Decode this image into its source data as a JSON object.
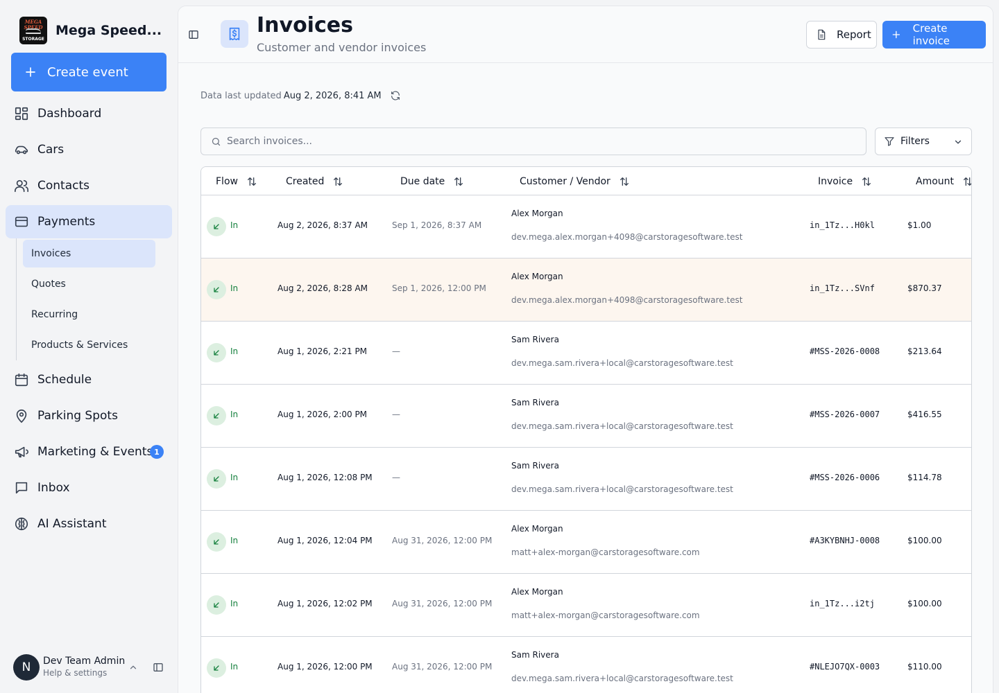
{
  "org": {
    "name": "Mega Speed...",
    "logo_text_top": "MEGA SPEED",
    "logo_text_bottom": "STORAGE"
  },
  "sidebar": {
    "create_event_label": "Create event",
    "items": [
      {
        "label": "Dashboard",
        "icon": "dashboard-icon"
      },
      {
        "label": "Cars",
        "icon": "car-icon"
      },
      {
        "label": "Contacts",
        "icon": "contacts-icon"
      },
      {
        "label": "Payments",
        "icon": "credit-card-icon"
      },
      {
        "label": "Schedule",
        "icon": "calendar-icon"
      },
      {
        "label": "Parking Spots",
        "icon": "map-pin-icon"
      },
      {
        "label": "Marketing & Events",
        "icon": "megaphone-icon",
        "badge": "1"
      },
      {
        "label": "Inbox",
        "icon": "message-icon"
      },
      {
        "label": "AI Assistant",
        "icon": "brain-icon"
      }
    ],
    "payments_sub": [
      {
        "label": "Invoices"
      },
      {
        "label": "Quotes"
      },
      {
        "label": "Recurring"
      },
      {
        "label": "Products & Services"
      }
    ]
  },
  "user": {
    "initial": "N",
    "name": "Dev Team Admin",
    "subtitle": "Help & settings"
  },
  "header": {
    "title": "Invoices",
    "subtitle": "Customer and vendor invoices",
    "report_label": "Report",
    "create_label": "Create invoice"
  },
  "status": {
    "updated_label": "Data last updated",
    "updated_value": "Aug 2, 2026, 8:41 AM"
  },
  "search": {
    "placeholder": "Search invoices..."
  },
  "filters_label": "Filters",
  "table": {
    "columns": [
      "Flow",
      "Created",
      "Due date",
      "Customer / Vendor",
      "Invoice",
      "Amount"
    ],
    "rows": [
      {
        "flow": "In",
        "created": "Aug 2, 2026, 8:37 AM",
        "due": "Sep 1, 2026, 8:37 AM",
        "name": "Alex Morgan",
        "email": "dev.mega.alex.morgan+4098@carstoragesoftware.test",
        "invoice": "in_1Tz...H0kl",
        "amount": "$1.00"
      },
      {
        "flow": "In",
        "created": "Aug 2, 2026, 8:28 AM",
        "due": "Sep 1, 2026, 12:00 PM",
        "name": "Alex Morgan",
        "email": "dev.mega.alex.morgan+4098@carstoragesoftware.test",
        "invoice": "in_1Tz...SVnf",
        "amount": "$870.37"
      },
      {
        "flow": "In",
        "created": "Aug 1, 2026, 2:21 PM",
        "due": "—",
        "name": "Sam Rivera",
        "email": "dev.mega.sam.rivera+local@carstoragesoftware.test",
        "invoice": "#MSS-2026-0008",
        "amount": "$213.64"
      },
      {
        "flow": "In",
        "created": "Aug 1, 2026, 2:00 PM",
        "due": "—",
        "name": "Sam Rivera",
        "email": "dev.mega.sam.rivera+local@carstoragesoftware.test",
        "invoice": "#MSS-2026-0007",
        "amount": "$416.55"
      },
      {
        "flow": "In",
        "created": "Aug 1, 2026, 12:08 PM",
        "due": "—",
        "name": "Sam Rivera",
        "email": "dev.mega.sam.rivera+local@carstoragesoftware.test",
        "invoice": "#MSS-2026-0006",
        "amount": "$114.78"
      },
      {
        "flow": "In",
        "created": "Aug 1, 2026, 12:04 PM",
        "due": "Aug 31, 2026, 12:00 PM",
        "name": "Alex Morgan",
        "email": "matt+alex-morgan@carstoragesoftware.com",
        "invoice": "#A3KYBNHJ-0008",
        "amount": "$100.00"
      },
      {
        "flow": "In",
        "created": "Aug 1, 2026, 12:02 PM",
        "due": "Aug 31, 2026, 12:00 PM",
        "name": "Alex Morgan",
        "email": "matt+alex-morgan@carstoragesoftware.com",
        "invoice": "in_1Tz...i2tj",
        "amount": "$100.00"
      },
      {
        "flow": "In",
        "created": "Aug 1, 2026, 12:00 PM",
        "due": "Aug 31, 2026, 12:00 PM",
        "name": "Sam Rivera",
        "email": "dev.mega.sam.rivera+local@carstoragesoftware.test",
        "invoice": "#NLEJO7QX-0003",
        "amount": "$110.00"
      }
    ]
  }
}
